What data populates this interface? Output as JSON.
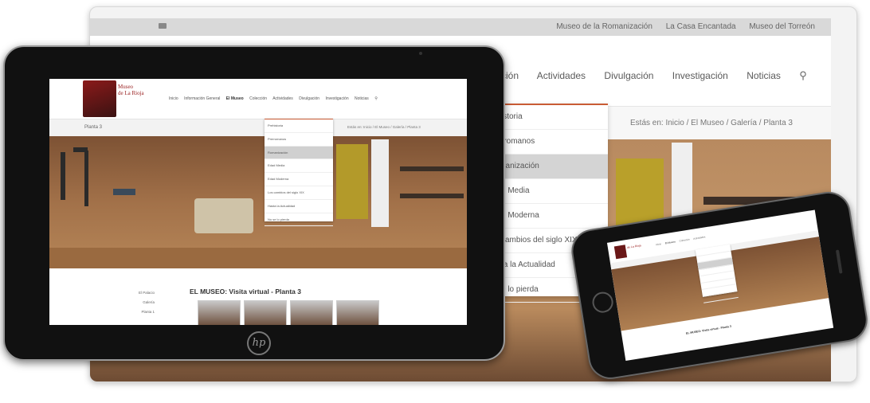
{
  "desktop": {
    "top_links": [
      "Museo de la Romanización",
      "La Casa Encantada",
      "Museo del Torreón"
    ],
    "nav": [
      "cción",
      "Actividades",
      "Divulgación",
      "Investigación",
      "Noticias"
    ],
    "breadcrumb": "Estás en:  Inicio  /  El Museo  /  Galería  /  Planta 3",
    "dropdown": [
      "istoria",
      "rromanos",
      "nanización",
      "d Media",
      "d Moderna",
      "cambios del siglo XIX",
      "ta la Actualidad",
      "e lo pierda"
    ],
    "dropdown_selected_index": 2
  },
  "tablet": {
    "logo_text_line1": "Museo",
    "logo_text_line2": "de La Rioja",
    "nav": [
      "Inicio",
      "Información General",
      "El Museo",
      "Colección",
      "Actividades",
      "Divulgación",
      "Investigación",
      "Noticias"
    ],
    "nav_active_index": 2,
    "page_label": "Planta 3",
    "breadcrumb": "Estás en:  Inicio  /  El Museo  /  Galería  /  Planta 3",
    "dropdown": [
      "Prehistoria",
      "Prerromanos",
      "Romanización",
      "Edad Media",
      "Edad Moderna",
      "Los cambios del siglo XIX",
      "Hasta la Actualidad",
      "No se lo pierda"
    ],
    "dropdown_selected_index": 2,
    "side_links": [
      "El Palacio",
      "Galería",
      "Planta 1"
    ],
    "section_title": "EL MUSEO: Visita virtual - Planta 3",
    "brand": "hp"
  },
  "phone": {
    "section_title": "EL MUSEO: Visita virtual - Planta 3"
  },
  "colors": {
    "accent": "#c95b34",
    "brand_red": "#9b2222",
    "dropdown_selected": "#d4d4d4"
  },
  "icons": {
    "search": "search-icon",
    "hp_logo": "hp-logo-icon"
  }
}
